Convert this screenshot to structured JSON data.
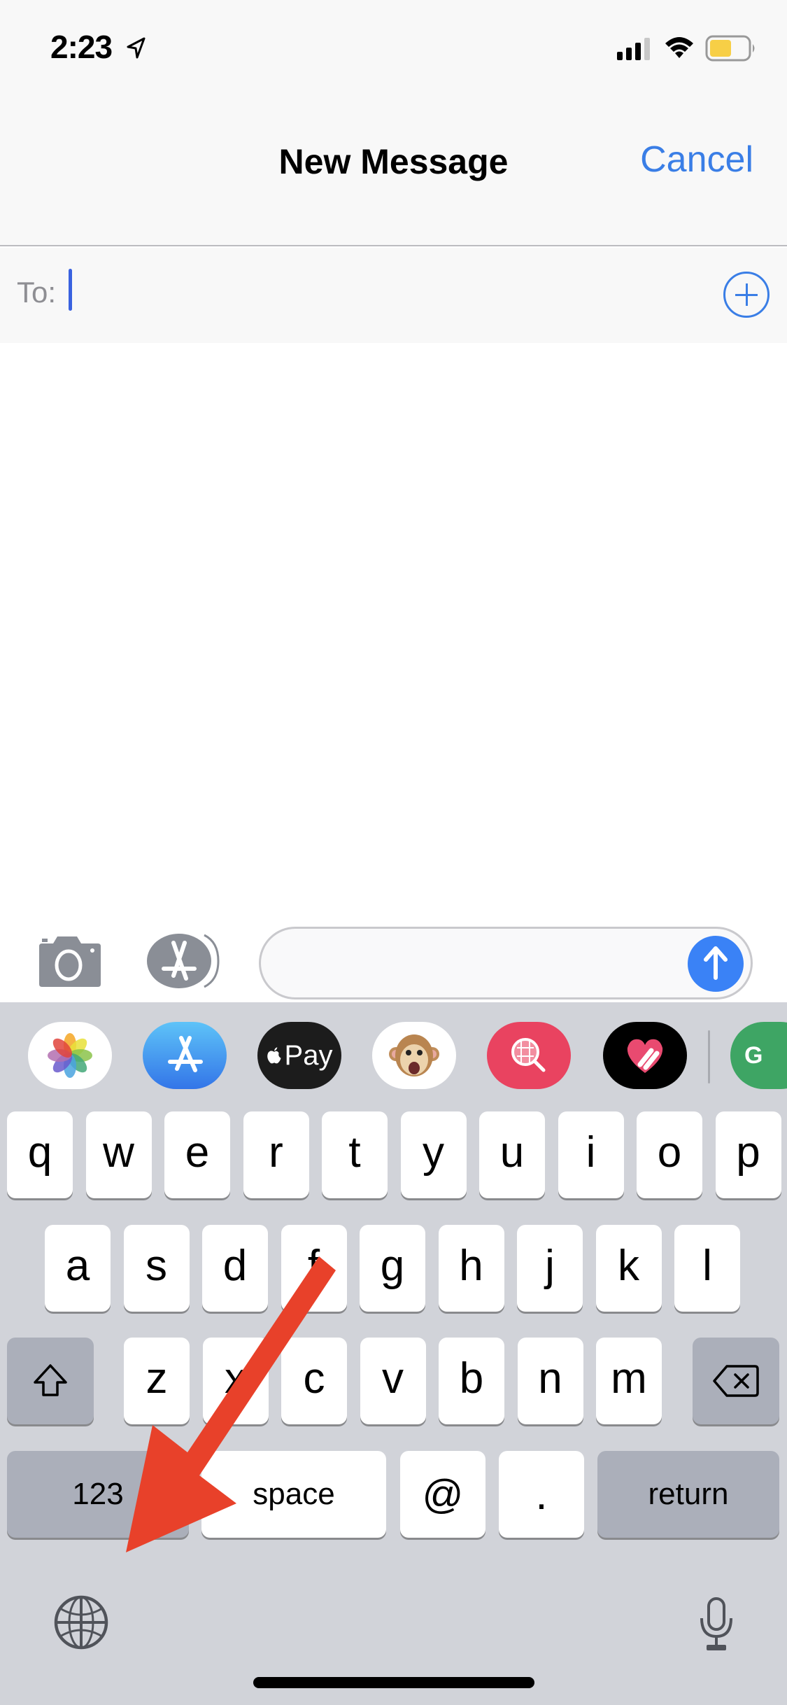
{
  "status_bar": {
    "time": "2:23",
    "icons": [
      "location-arrow-icon",
      "signal-icon",
      "wifi-icon",
      "battery-icon"
    ],
    "battery_color": "#f7cf46"
  },
  "nav": {
    "title": "New Message",
    "cancel_label": "Cancel",
    "accent_color": "#3a7ee6"
  },
  "to_field": {
    "label": "To:",
    "value": "",
    "add_contact_icon": "plus-circle-icon"
  },
  "compose": {
    "camera_icon": "camera-icon",
    "apps_icon": "app-store-icon",
    "message_value": "",
    "send_icon": "arrow-up-icon"
  },
  "app_strip": [
    {
      "name": "Photos",
      "icon": "photos-icon"
    },
    {
      "name": "App Store",
      "icon": "app-store-icon"
    },
    {
      "name": "Apple Pay",
      "label": "Pay",
      "icon": "apple-pay-icon"
    },
    {
      "name": "Animoji",
      "icon": "monkey-animoji-icon"
    },
    {
      "name": "Images Search",
      "icon": "globe-search-icon"
    },
    {
      "name": "Digital Touch",
      "icon": "heart-touch-icon"
    },
    {
      "name": "Google Maps",
      "label": "G",
      "icon": "google-maps-icon"
    }
  ],
  "keyboard": {
    "row1": [
      "q",
      "w",
      "e",
      "r",
      "t",
      "y",
      "u",
      "i",
      "o",
      "p"
    ],
    "row2": [
      "a",
      "s",
      "d",
      "f",
      "g",
      "h",
      "j",
      "k",
      "l"
    ],
    "row3": [
      "z",
      "x",
      "c",
      "v",
      "b",
      "n",
      "m"
    ],
    "shift_icon": "shift-icon",
    "delete_icon": "delete-icon",
    "numbers_label": "123",
    "space_label": "space",
    "at_label": "@",
    "period_label": ".",
    "return_label": "return",
    "globe_icon": "globe-icon",
    "mic_icon": "microphone-icon"
  },
  "annotation": {
    "type": "arrow",
    "color": "#e8412a",
    "points_to": "numbers-key"
  }
}
